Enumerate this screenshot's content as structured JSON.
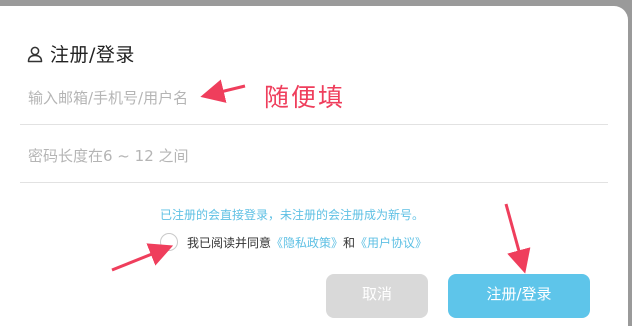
{
  "dialog": {
    "title": "注册/登录",
    "icon": "user-icon"
  },
  "form": {
    "username_placeholder": "输入邮箱/手机号/用户名",
    "username_value": "",
    "password_placeholder": "密码长度在6 ~ 12 之间",
    "password_value": ""
  },
  "hint": "已注册的会直接登录，未注册的会注册成为新号。",
  "agreement": {
    "checked": false,
    "prefix": "我已阅读并同意",
    "privacy_link": "《隐私政策》",
    "and": "和",
    "terms_link": "《用户协议》"
  },
  "buttons": {
    "cancel": "取消",
    "submit": "注册/登录"
  },
  "annotation": {
    "text": "随便填",
    "color": "#ef3e5c"
  },
  "colors": {
    "accent": "#5ec5ea",
    "annotation": "#ef3e5c"
  }
}
